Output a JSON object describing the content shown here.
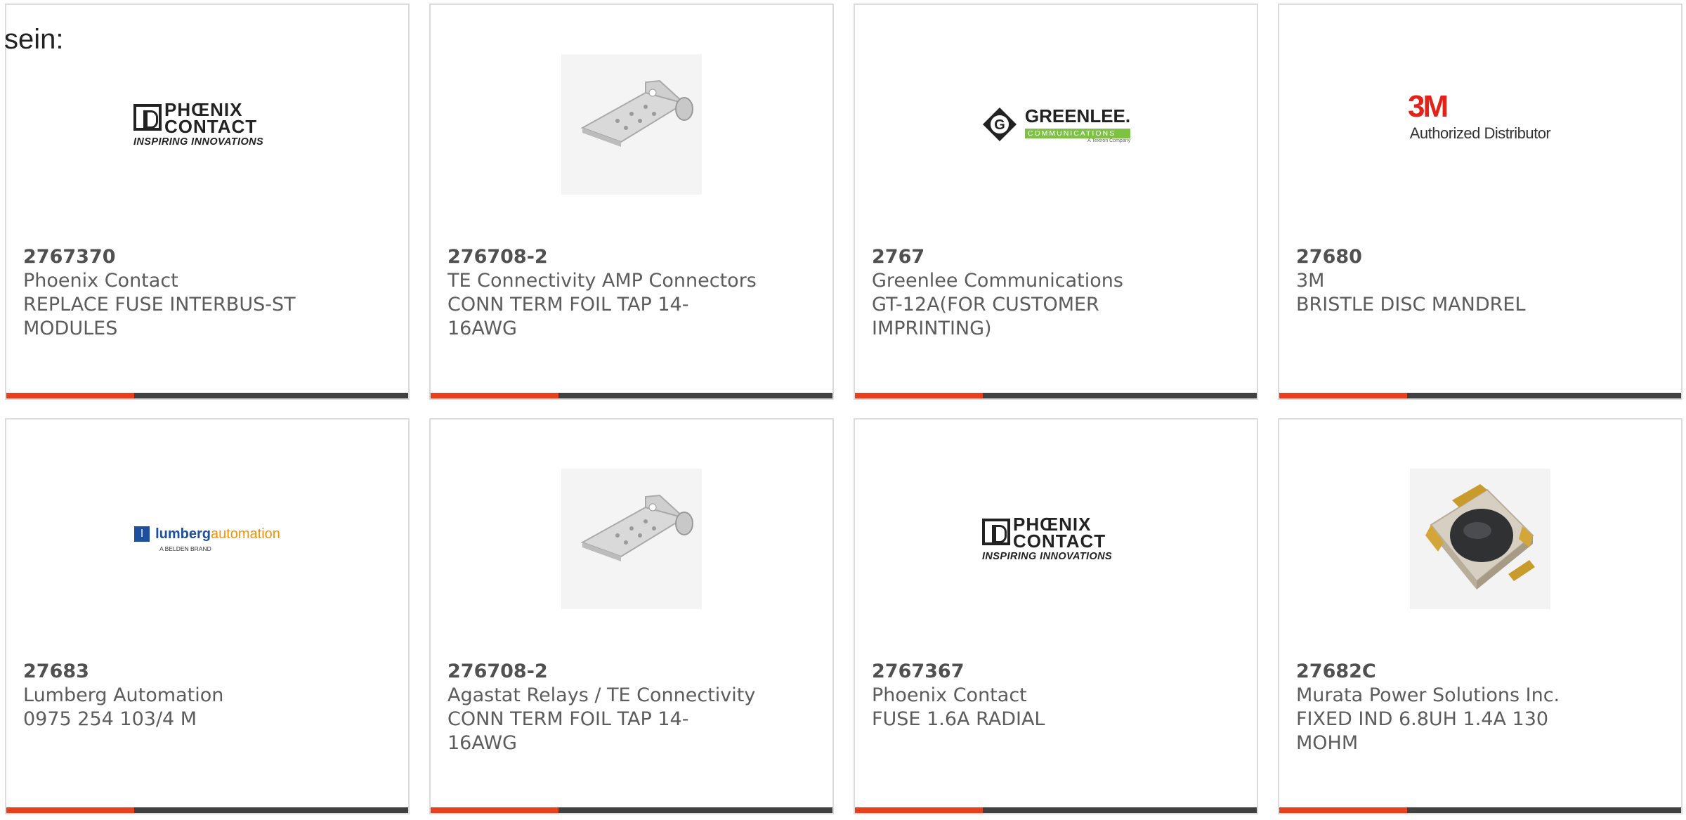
{
  "page": {
    "heading": "sein:"
  },
  "colors": {
    "accent": "#e8401c",
    "bar": "#404040",
    "border": "#dcdcdc"
  },
  "products": [
    {
      "part_number": "2767370",
      "manufacturer": "Phoenix Contact",
      "description": "REPLACE FUSE INTERBUS-ST MODULES",
      "logo": "phoenix-contact-logo"
    },
    {
      "part_number": "276708-2",
      "manufacturer": "TE Connectivity AMP Connectors",
      "description": "CONN TERM FOIL TAP 14-16AWG",
      "logo": "foil-tap-terminal-image"
    },
    {
      "part_number": "2767",
      "manufacturer": "Greenlee Communications",
      "description": "GT-12A(FOR CUSTOMER IMPRINTING)",
      "logo": "greenlee-logo"
    },
    {
      "part_number": "27680",
      "manufacturer": "3M",
      "description": "BRISTLE DISC MANDREL",
      "logo": "3m-logo"
    },
    {
      "part_number": "27683",
      "manufacturer": "Lumberg Automation",
      "description": "0975 254 103/4 M",
      "logo": "lumberg-automation-logo"
    },
    {
      "part_number": "276708-2",
      "manufacturer": "Agastat Relays / TE Connectivity",
      "description": "CONN TERM FOIL TAP 14-16AWG",
      "logo": "foil-tap-terminal-image"
    },
    {
      "part_number": "2767367",
      "manufacturer": "Phoenix Contact",
      "description": "FUSE 1.6A RADIAL",
      "logo": "phoenix-contact-logo"
    },
    {
      "part_number": "27682C",
      "manufacturer": "Murata Power Solutions Inc.",
      "description": "FIXED IND 6.8UH 1.4A 130 MOHM",
      "logo": "smd-inductor-image"
    }
  ],
  "logos": {
    "phoenix": {
      "line1": "PHŒNIX",
      "line2": "CONTACT",
      "tagline": "INSPIRING INNOVATIONS"
    },
    "greenlee": {
      "word": "GREENLEE.",
      "sub": "COMMUNICATIONS",
      "sub2": "A Textron Company"
    },
    "3m": {
      "mark": "3M",
      "text": "Authorized Distributor"
    },
    "lumberg": {
      "square": "l",
      "w1": "lumberg",
      "w2": "automation",
      "sub": "A BELDEN BRAND"
    }
  }
}
